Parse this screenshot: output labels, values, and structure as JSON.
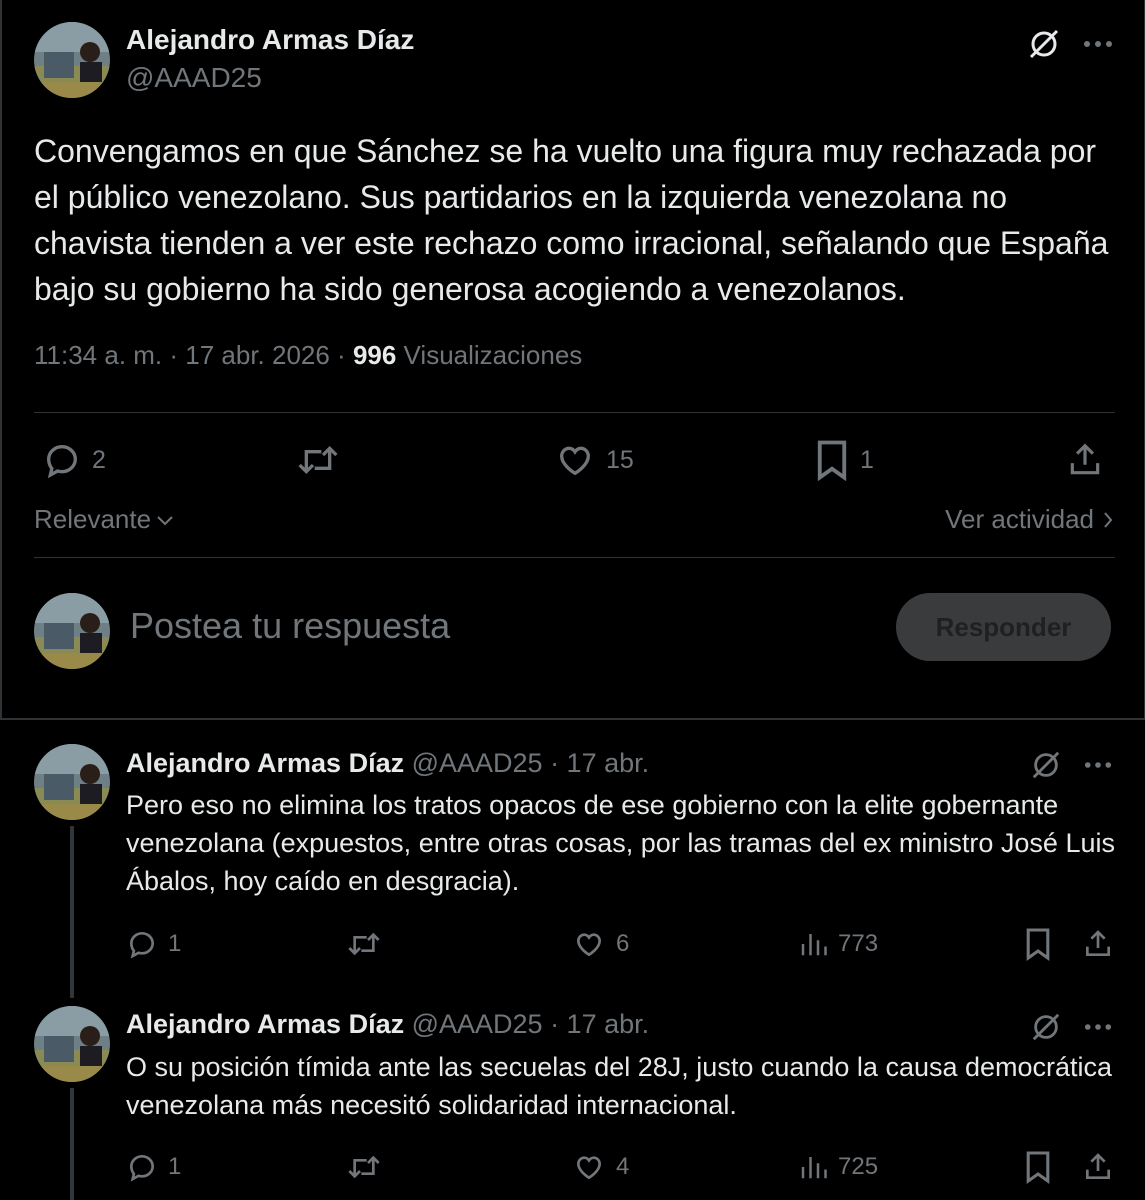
{
  "main_post": {
    "author_name": "Alejandro Armas Díaz",
    "author_handle": "@AAAD25",
    "text": "Convengamos en que Sánchez se ha vuelto una figura muy rechazada por el público venezolano. Sus partidarios en la izquierda venezolana no chavista tienden a ver este rechazo como irracional, señalando que España bajo su gobierno ha sido generosa acogiendo a venezolanos.",
    "timestamp": "11:34 a. m. · 17 abr. 2026 · ",
    "views_count": "996",
    "views_label": " Visualizaciones",
    "stats": {
      "replies": "2",
      "likes": "15",
      "bookmarks": "1"
    }
  },
  "sort": {
    "label": "Relevante",
    "activity_label": "Ver actividad"
  },
  "composer": {
    "placeholder": "Postea tu respuesta",
    "submit_label": "Responder"
  },
  "replies": [
    {
      "author_name": "Alejandro Armas Díaz",
      "meta": " @AAAD25 · 17 abr.",
      "text": "Pero eso no elimina los tratos opacos de ese gobierno con la elite gobernante venezolana (expuestos, entre otras cosas, por las tramas del ex ministro José Luis Ábalos, hoy caído en desgracia).",
      "replies": "1",
      "likes": "6",
      "views": "773"
    },
    {
      "author_name": "Alejandro Armas Díaz",
      "meta": " @AAAD25 · 17 abr.",
      "text": "O su posición tímida ante las secuelas del 28J, justo cuando la causa democrática venezolana más necesitó solidaridad internacional.",
      "replies": "1",
      "likes": "4",
      "views": "725"
    }
  ],
  "icons": {
    "reply": "speech-bubble-icon",
    "repost": "repost-arrows-icon",
    "like": "heart-icon",
    "bookmark": "bookmark-icon",
    "share": "share-upload-icon",
    "views": "bar-chart-icon",
    "grok": "grok-slash-icon",
    "more": "more-dots-icon"
  },
  "colors": {
    "background": "#000000",
    "text_primary": "#e7e9ea",
    "text_secondary": "#71767b",
    "divider": "#2f3336",
    "button_disabled": "#3a3b3c"
  }
}
